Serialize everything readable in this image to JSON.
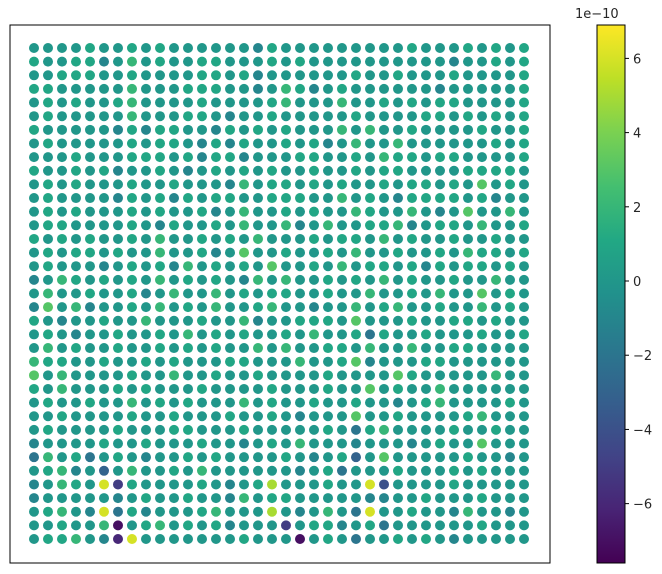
{
  "chart_data": {
    "type": "scatter",
    "title": "",
    "xlabel": "",
    "ylabel": "",
    "grid": false,
    "axes_ticks_visible": false,
    "grid_shape": {
      "cols": 36,
      "rows": 36
    },
    "colormap": "viridis",
    "colorbar": {
      "range": [
        -7.6,
        6.9
      ],
      "ticks": [
        -6,
        -4,
        -2,
        0,
        2,
        4,
        6
      ],
      "tick_labels": [
        "−6",
        "−4",
        "−2",
        "0",
        "2",
        "4",
        "6"
      ],
      "multiplier_label": "1e−10",
      "location": "right"
    },
    "value_unit": "1e-10",
    "values_rows_top_to_bottom": [
      [
        0,
        0,
        0,
        0,
        1,
        0,
        0,
        1,
        0,
        1,
        0,
        0,
        0,
        0,
        0,
        0,
        -1,
        1,
        0,
        0,
        0,
        0,
        0,
        0,
        0,
        0,
        0,
        1,
        0,
        0,
        0,
        1,
        0,
        1,
        0,
        1
      ],
      [
        1,
        0,
        0,
        1,
        1,
        -1,
        0,
        2,
        0,
        1,
        0,
        0,
        1,
        1,
        0,
        0,
        0,
        1,
        0,
        1,
        0,
        0,
        0,
        0,
        0,
        0,
        0,
        0,
        0,
        0,
        -1,
        0,
        0,
        1,
        0,
        1
      ],
      [
        0,
        0,
        1,
        1,
        1,
        0,
        0,
        1,
        0,
        0,
        0,
        0,
        1,
        1,
        0,
        1,
        -1,
        0,
        0,
        0,
        0,
        0,
        0,
        1,
        0,
        0,
        1,
        0,
        0,
        0,
        1,
        0,
        0,
        0,
        0,
        1
      ],
      [
        1,
        1,
        0,
        0,
        0,
        0,
        0,
        2,
        0,
        0,
        0,
        1,
        1,
        1,
        0,
        0,
        -1,
        0,
        2,
        1,
        -1,
        0,
        1,
        0,
        0,
        0,
        0,
        0,
        0,
        -1,
        0,
        0,
        0,
        0,
        0,
        1
      ],
      [
        0,
        1,
        0,
        1,
        0,
        0,
        1,
        2,
        0,
        0,
        0,
        0,
        1,
        0,
        0,
        0,
        0,
        1,
        2,
        0,
        0,
        0,
        2,
        0,
        0,
        1,
        0,
        1,
        0,
        1,
        1,
        0,
        0,
        0,
        0,
        1
      ],
      [
        0,
        1,
        0,
        0,
        0,
        0,
        0,
        2,
        0,
        0,
        0,
        1,
        1,
        0,
        -1,
        0,
        0,
        1,
        0,
        0,
        0,
        0,
        0,
        1,
        0,
        0,
        0,
        0,
        1,
        1,
        0,
        1,
        0,
        1,
        0,
        1
      ],
      [
        1,
        0,
        0,
        0,
        0,
        0,
        -1,
        1,
        -1,
        1,
        1,
        0,
        0,
        -1,
        1,
        0,
        1,
        0,
        1,
        0,
        0,
        0,
        2,
        0,
        2,
        0,
        0,
        1,
        0,
        0,
        0,
        0,
        1,
        0,
        0,
        1
      ],
      [
        0,
        1,
        0,
        0,
        0,
        0,
        0,
        1,
        0,
        1,
        1,
        0,
        -1,
        1,
        -1,
        1,
        0,
        0,
        1,
        0,
        1,
        -1,
        0,
        2,
        0,
        0,
        2,
        0,
        0,
        0,
        0,
        0,
        0,
        1,
        0,
        1
      ],
      [
        0,
        0,
        0,
        1,
        0,
        0,
        0,
        1,
        1,
        1,
        0,
        1,
        -1,
        1,
        1,
        -1,
        0,
        0,
        0,
        1,
        1,
        0,
        0,
        1,
        0,
        2,
        1,
        1,
        0,
        1,
        1,
        0,
        0,
        0,
        0,
        1
      ],
      [
        1,
        0,
        0,
        1,
        0,
        1,
        -1,
        0,
        0,
        1,
        0,
        -1,
        0,
        1,
        0,
        1,
        0,
        1,
        0,
        0,
        1,
        0,
        0,
        1,
        0,
        1,
        1,
        0,
        0,
        0,
        0,
        1,
        1,
        1,
        1,
        0
      ],
      [
        0,
        1,
        0,
        1,
        0,
        0,
        0,
        1,
        0,
        0,
        1,
        0,
        0,
        0,
        -1,
        2,
        0,
        1,
        1,
        0,
        1,
        0,
        1,
        0,
        0,
        1,
        0,
        1,
        1,
        0,
        1,
        0,
        3,
        0,
        1,
        0
      ],
      [
        0,
        1,
        0,
        0,
        0,
        0,
        -1,
        1,
        0,
        1,
        -1,
        1,
        0,
        1,
        1,
        0,
        0,
        1,
        1,
        1,
        0,
        0,
        2,
        0,
        1,
        0,
        -1,
        1,
        1,
        1,
        1,
        0,
        1,
        -1,
        0,
        0
      ],
      [
        0,
        1,
        0,
        1,
        0,
        0,
        0,
        1,
        0,
        1,
        0,
        0,
        1,
        -1,
        0,
        2,
        0,
        0,
        1,
        0,
        1,
        0,
        0,
        2,
        1,
        0,
        0,
        2,
        0,
        -1,
        0,
        3,
        0,
        0,
        2,
        0
      ],
      [
        0,
        1,
        1,
        0,
        0,
        0,
        0,
        1,
        0,
        -1,
        1,
        0,
        0,
        1,
        0,
        2,
        0,
        0,
        2,
        -1,
        0,
        2,
        0,
        0,
        1,
        1,
        2,
        -1,
        0,
        1,
        1,
        0,
        2,
        0,
        0,
        1
      ],
      [
        1,
        0,
        1,
        0,
        1,
        0,
        0,
        1,
        0,
        2,
        0,
        0,
        1,
        0,
        1,
        0,
        2,
        0,
        0,
        0,
        1,
        0,
        1,
        1,
        0,
        2,
        0,
        1,
        0,
        0,
        1,
        0,
        0,
        1,
        0,
        0
      ],
      [
        0,
        1,
        0,
        1,
        1,
        0,
        1,
        0,
        0,
        2,
        0,
        0,
        1,
        -1,
        0,
        3,
        0,
        0,
        1,
        0,
        0,
        1,
        0,
        2,
        0,
        0,
        1,
        0,
        0,
        1,
        0,
        2,
        1,
        1,
        0,
        1
      ],
      [
        0,
        1,
        0,
        0,
        0,
        -1,
        0,
        1,
        0,
        1,
        -1,
        2,
        0,
        1,
        0,
        1,
        0,
        3,
        0,
        0,
        1,
        0,
        2,
        0,
        1,
        1,
        0,
        1,
        -1,
        1,
        0,
        1,
        1,
        0,
        1,
        0
      ],
      [
        -1,
        0,
        2,
        1,
        0,
        1,
        0,
        1,
        0,
        2,
        0,
        1,
        0,
        1,
        0,
        -1,
        2,
        0,
        2,
        0,
        0,
        1,
        0,
        1,
        0,
        2,
        0,
        1,
        0,
        0,
        1,
        0,
        0,
        2,
        0,
        0
      ],
      [
        0,
        2,
        0,
        0,
        1,
        0,
        0,
        1,
        -1,
        0,
        2,
        0,
        0,
        2,
        0,
        1,
        0,
        1,
        1,
        0,
        0,
        1,
        0,
        0,
        2,
        0,
        0,
        1,
        0,
        2,
        0,
        0,
        3,
        0,
        1,
        0
      ],
      [
        -1,
        3,
        0,
        2,
        -1,
        0,
        0,
        1,
        0,
        2,
        0,
        1,
        0,
        2,
        0,
        0,
        1,
        2,
        0,
        0,
        -1,
        0,
        0,
        2,
        0,
        1,
        2,
        0,
        0,
        1,
        0,
        0,
        2,
        0,
        1,
        0
      ],
      [
        1,
        0,
        -1,
        0,
        0,
        1,
        0,
        0,
        2,
        0,
        0,
        0,
        1,
        0,
        0,
        2,
        -1,
        0,
        0,
        1,
        1,
        1,
        0,
        3,
        0,
        0,
        0,
        1,
        0,
        0,
        1,
        1,
        0,
        1,
        0,
        0
      ],
      [
        0,
        1,
        0,
        -1,
        0,
        0,
        1,
        0,
        0,
        1,
        0,
        2,
        0,
        1,
        0,
        1,
        0,
        0,
        1,
        0,
        2,
        0,
        0,
        1,
        -2,
        1,
        0,
        0,
        1,
        0,
        0,
        0,
        1,
        0,
        0,
        1
      ],
      [
        0,
        2,
        0,
        1,
        0,
        0,
        1,
        0,
        0,
        1,
        0,
        1,
        0,
        1,
        0,
        0,
        2,
        0,
        2,
        0,
        0,
        1,
        1,
        0,
        2,
        0,
        0,
        2,
        0,
        0,
        1,
        1,
        0,
        0,
        0,
        0
      ],
      [
        2,
        1,
        1,
        0,
        0,
        1,
        0,
        0,
        1,
        0,
        1,
        0,
        0,
        0,
        1,
        1,
        0,
        0,
        0,
        2,
        0,
        0,
        1,
        3,
        -1,
        0,
        0,
        0,
        1,
        1,
        0,
        0,
        0,
        0,
        0,
        0
      ],
      [
        3,
        0,
        2,
        0,
        0,
        0,
        0,
        1,
        0,
        0,
        2,
        0,
        0,
        1,
        0,
        0,
        1,
        0,
        0,
        0,
        0,
        1,
        0,
        0,
        0,
        0,
        3,
        1,
        0,
        0,
        0,
        0,
        0,
        2,
        0,
        0
      ],
      [
        1,
        0,
        2,
        0,
        0,
        0,
        1,
        0,
        1,
        0,
        0,
        0,
        1,
        0,
        0,
        0,
        0,
        1,
        0,
        0,
        0,
        1,
        0,
        0,
        3,
        0,
        1,
        0,
        0,
        2,
        0,
        0,
        0,
        0,
        0,
        0
      ],
      [
        0,
        1,
        0,
        0,
        1,
        0,
        0,
        2,
        0,
        1,
        0,
        1,
        0,
        0,
        0,
        2,
        0,
        1,
        0,
        0,
        1,
        0,
        0,
        1,
        0,
        0,
        -1,
        0,
        1,
        2,
        0,
        0,
        0,
        0,
        1,
        0
      ],
      [
        0,
        0,
        1,
        0,
        0,
        0,
        0,
        1,
        0,
        0,
        1,
        0,
        0,
        0,
        1,
        0,
        0,
        1,
        0,
        -1,
        0,
        0,
        0,
        3,
        0,
        0,
        1,
        0,
        0,
        0,
        0,
        1,
        2,
        0,
        0,
        0
      ],
      [
        0,
        1,
        0,
        0,
        0,
        0,
        1,
        0,
        0,
        0,
        1,
        1,
        0,
        0,
        0,
        1,
        0,
        0,
        0,
        0,
        0,
        1,
        0,
        -2,
        1,
        2,
        0,
        0,
        0,
        0,
        1,
        0,
        0,
        1,
        0,
        0
      ],
      [
        -1,
        0,
        0,
        0,
        0,
        1,
        0,
        0,
        1,
        0,
        0,
        0,
        1,
        0,
        0,
        -1,
        0,
        1,
        0,
        2,
        0,
        0,
        0,
        -1,
        0,
        0,
        0,
        -1,
        0,
        1,
        0,
        0,
        3,
        0,
        0,
        0
      ],
      [
        -2,
        2,
        0,
        1,
        -2,
        0,
        1,
        0,
        -1,
        0,
        0,
        1,
        0,
        1,
        0,
        0,
        0,
        0,
        1,
        0,
        -1,
        0,
        1,
        -3,
        0,
        3,
        0,
        0,
        0,
        0,
        0,
        1,
        0,
        0,
        -1,
        0
      ],
      [
        0,
        1,
        2,
        -1,
        0,
        -3,
        0,
        2,
        0,
        0,
        1,
        0,
        2,
        0,
        0,
        0,
        0,
        0,
        0,
        -1,
        0,
        1,
        -2,
        0,
        0,
        0,
        1,
        0,
        0,
        0,
        1,
        0,
        1,
        0,
        0,
        0
      ],
      [
        -1,
        0,
        2,
        1,
        0,
        6,
        -5,
        1,
        0,
        0,
        0,
        0,
        1,
        0,
        -1,
        0,
        1,
        5,
        0,
        0,
        0,
        1,
        0,
        0,
        6,
        -4,
        0,
        0,
        0,
        0,
        1,
        0,
        0,
        0,
        0,
        0
      ],
      [
        -1,
        0,
        0,
        0,
        0,
        0,
        -1,
        0,
        1,
        0,
        0,
        1,
        0,
        0,
        -1,
        2,
        0,
        1,
        1,
        0,
        0,
        0,
        0,
        0,
        -1,
        -1,
        0,
        0,
        1,
        0,
        0,
        0,
        1,
        0,
        0,
        0
      ],
      [
        0,
        1,
        2,
        0,
        -1,
        6,
        -2,
        1,
        -1,
        0,
        0,
        0,
        1,
        2,
        0,
        0,
        0,
        5,
        0,
        -1,
        0,
        2,
        0,
        -2,
        6,
        0,
        0,
        1,
        0,
        0,
        -1,
        2,
        0,
        0,
        -1,
        0
      ],
      [
        0,
        0,
        1,
        0,
        0,
        2,
        -7,
        0,
        1,
        2,
        0,
        1,
        0,
        1,
        -1,
        0,
        0,
        0,
        -5,
        0,
        1,
        1,
        -1,
        0,
        1,
        -2,
        0,
        0,
        0,
        0,
        0,
        0,
        1,
        0,
        0,
        0
      ],
      [
        0,
        1,
        1,
        2,
        0,
        -1,
        -6,
        6,
        0,
        0,
        0,
        0,
        0,
        0,
        0,
        1,
        0,
        0,
        0,
        -7,
        0,
        1,
        0,
        -2,
        0,
        0,
        1,
        0,
        1,
        0,
        -1,
        0,
        0,
        0,
        0,
        0
      ]
    ]
  }
}
